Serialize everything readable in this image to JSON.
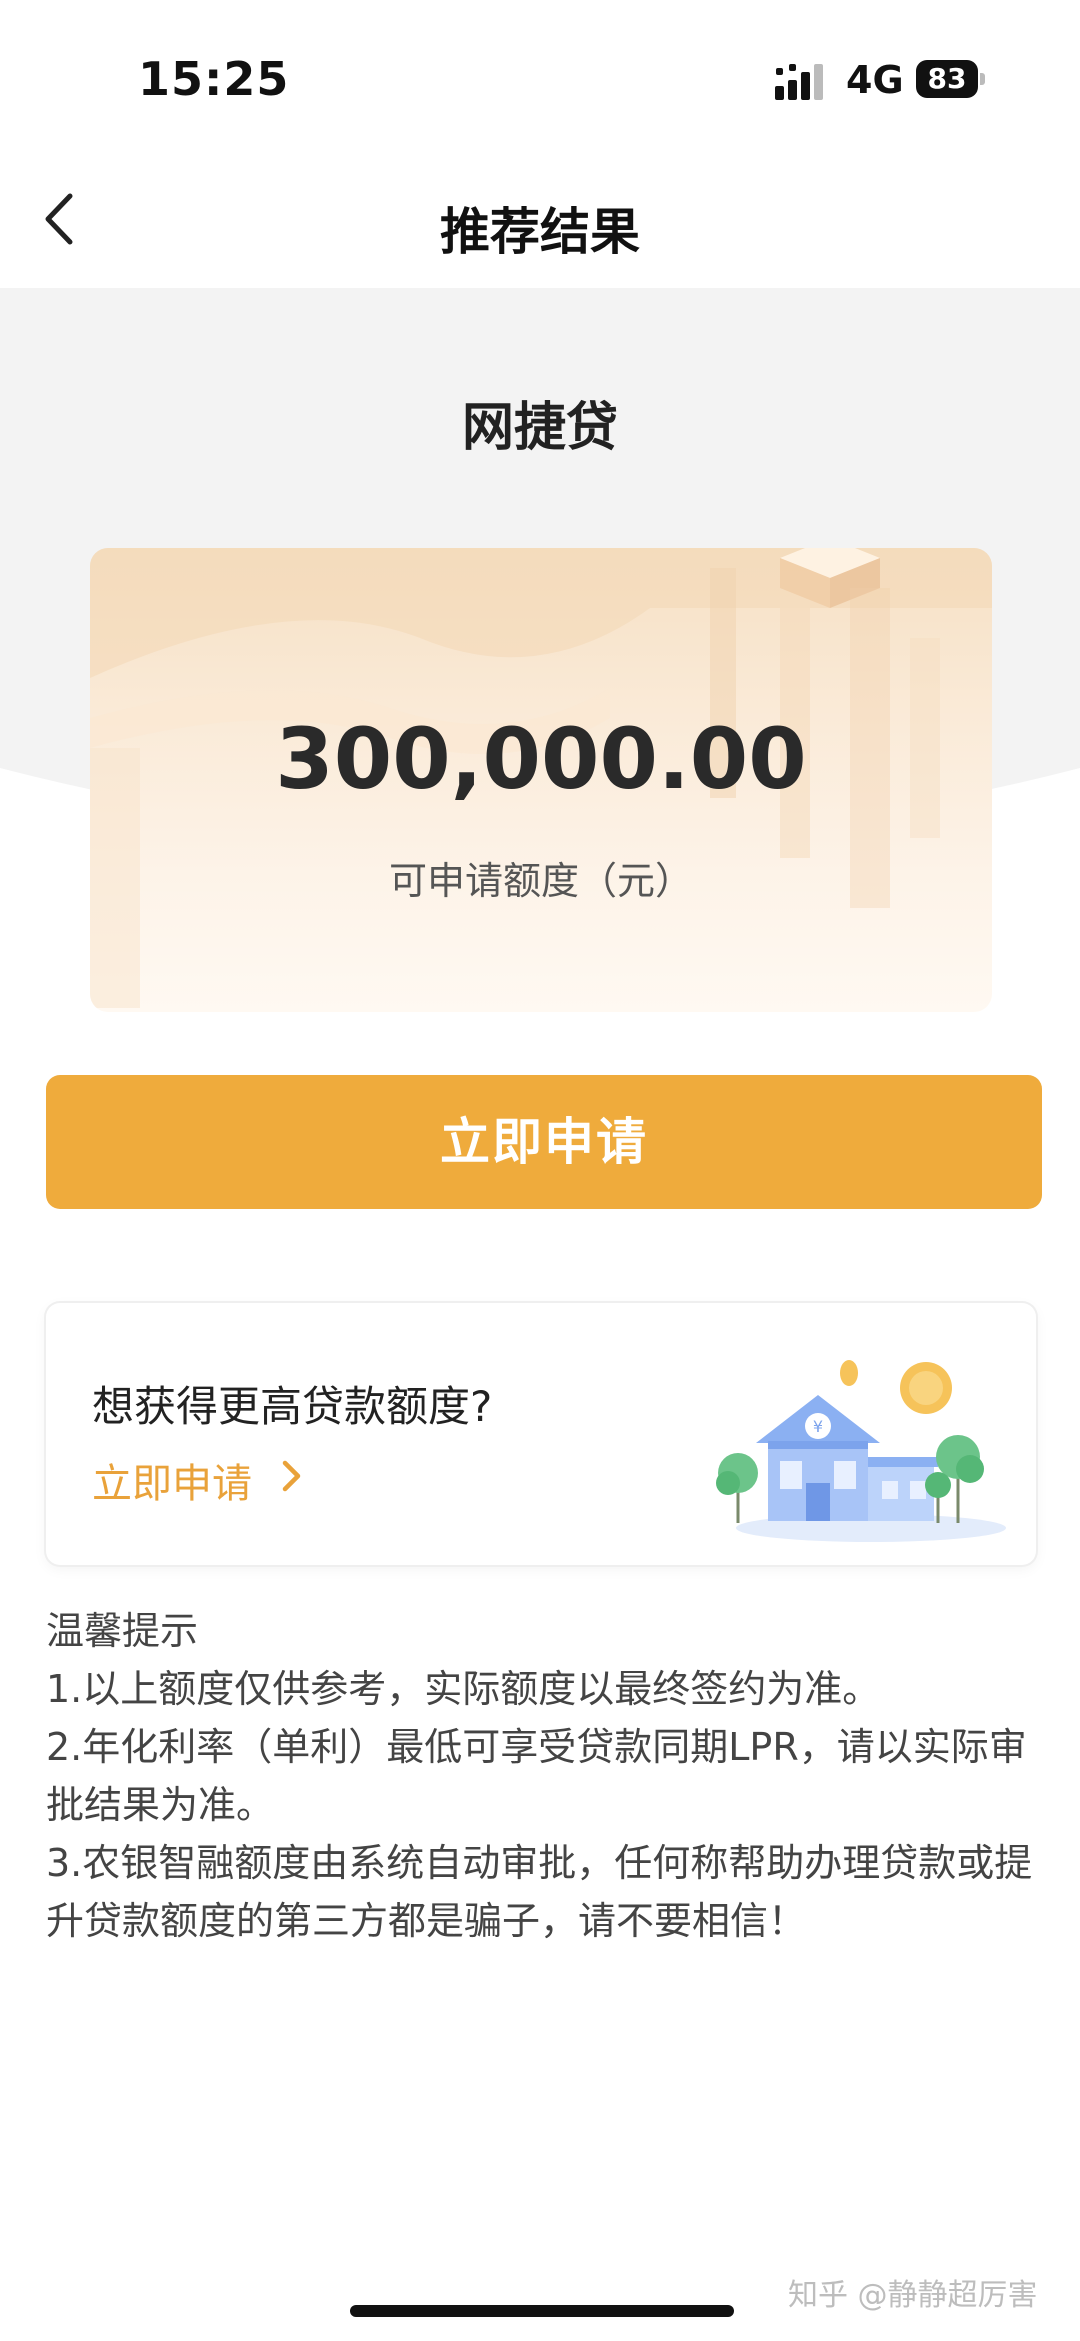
{
  "status_bar": {
    "time": "15:25",
    "network": "4G",
    "battery": "83"
  },
  "nav": {
    "title": "推荐结果"
  },
  "product": {
    "name": "网捷贷"
  },
  "amount_card": {
    "amount": "300,000.00",
    "label": "可申请额度（元）"
  },
  "apply_button": {
    "label": "立即申请"
  },
  "promo": {
    "title": "想获得更高贷款额度?",
    "link_label": "立即申请",
    "icon": "bank-building-illustration"
  },
  "tips": {
    "heading": "温馨提示",
    "items": [
      "1.以上额度仅供参考，实际额度以最终签约为准。",
      "2.年化利率（单利）最低可享受贷款同期LPR，请以实际审批结果为准。",
      "3.农银智融额度由系统自动审批，任何称帮助办理贷款或提升贷款额度的第三方都是骗子，请不要相信！"
    ]
  },
  "watermark": "知乎 @静静超厉害",
  "colors": {
    "accent": "#efab3c",
    "link": "#e9a23a",
    "card_gradient_top": "#f6e0c4"
  }
}
